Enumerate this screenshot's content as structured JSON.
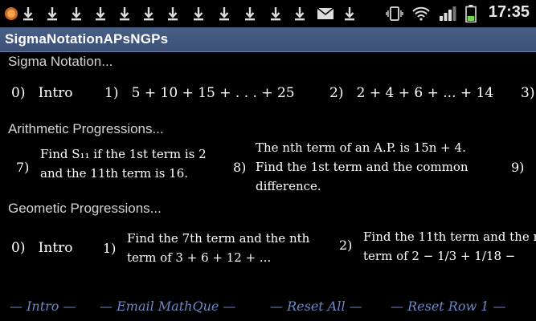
{
  "status": {
    "time": "17:35",
    "icons": [
      "app-notification-icon",
      "download-icon",
      "download-icon",
      "download-icon",
      "download-icon",
      "download-icon",
      "download-icon",
      "download-icon",
      "download-icon",
      "download-icon",
      "download-icon",
      "download-icon",
      "email-icon",
      "download-icon",
      "vibrate-icon",
      "wifi-icon",
      "signal-icon",
      "battery-icon"
    ]
  },
  "app": {
    "title": "SigmaNotationAPsNGPs"
  },
  "sigma": {
    "heading": "Sigma Notation...",
    "items": [
      {
        "num": "0)",
        "label": "Intro"
      },
      {
        "num": "1)",
        "label": "5 + 10 + 15 + . . .  + 25"
      },
      {
        "num": "2)",
        "label": "2 + 4 + 6 + ... + 14"
      },
      {
        "num": "3)",
        "label": ""
      }
    ]
  },
  "arithmetic": {
    "heading": "Arithmetic Progressions...",
    "items": [
      {
        "num": "7)",
        "line1": "Find S₁₁ if the 1st term is 2",
        "line2": "and the 11th term is 16."
      },
      {
        "num": "8)",
        "line1": "The nth term of an A.P. is 15n + 4.",
        "line2": "Find the 1st term and the common",
        "line3": "difference."
      },
      {
        "num": "9)"
      }
    ]
  },
  "geometric": {
    "heading": "Geometic Progressions...",
    "items": [
      {
        "num": "0)",
        "label": "Intro"
      },
      {
        "num": "1)",
        "line1": "Find the 7th term and the nth",
        "line2": "term of 3 + 6 + 12 + ..."
      },
      {
        "num": "2)",
        "line1": "Find the 11th term and the n",
        "line2": "term of 2 − 1/3 + 1/18 −"
      }
    ]
  },
  "footer": {
    "intro": "— Intro —",
    "email": "— Email MathQue —",
    "reset_all": "— Reset All —",
    "reset_row": "— Reset Row 1 —"
  },
  "colors": {
    "titlebar": "#3f5580",
    "footer_link": "#6c88c4",
    "section_text": "#d4d4d4"
  }
}
